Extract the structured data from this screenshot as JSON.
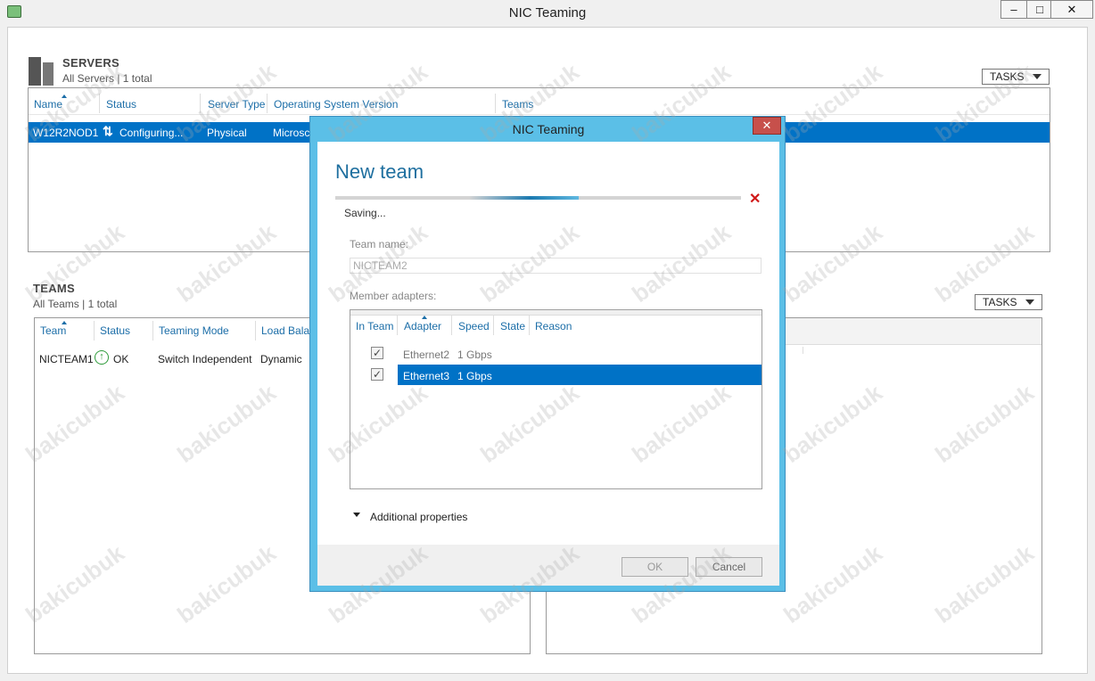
{
  "window": {
    "title": "NIC Teaming",
    "minimize": "–",
    "maximize": "□",
    "close": "✕"
  },
  "servers": {
    "title": "SERVERS",
    "subtitle": "All Servers | 1 total",
    "tasks": "TASKS",
    "columns": [
      "Name",
      "Status",
      "Server Type",
      "Operating System Version",
      "Teams"
    ],
    "row": {
      "name": "W12R2NOD1",
      "status": "Configuring...",
      "type": "Physical",
      "os": "Microsc"
    }
  },
  "teams": {
    "title": "TEAMS",
    "subtitle": "All Teams | 1 total",
    "tasks": "TASKS",
    "columns": [
      "Team",
      "Status",
      "Teaming Mode",
      "Load Balar"
    ],
    "row": {
      "team": "NICTEAM1",
      "status": "OK",
      "mode": "Switch Independent",
      "lb": "Dynamic"
    }
  },
  "dialog": {
    "title": "NIC Teaming",
    "close": "✕",
    "heading": "New team",
    "progress": 0.6,
    "cancel_icon": "✕",
    "status": "Saving...",
    "team_name_label": "Team name:",
    "team_name_value": "NICTEAM2",
    "member_label": "Member adapters:",
    "adapter_columns": [
      "In Team",
      "Adapter",
      "Speed",
      "State",
      "Reason"
    ],
    "adapters": [
      {
        "adapter": "Ethernet2",
        "speed": "1 Gbps",
        "checked": true
      },
      {
        "adapter": "Ethernet3",
        "speed": "1 Gbps",
        "checked": true
      }
    ],
    "additional": "Additional properties",
    "ok": "OK",
    "cancel": "Cancel"
  },
  "watermark": "bakicubuk"
}
